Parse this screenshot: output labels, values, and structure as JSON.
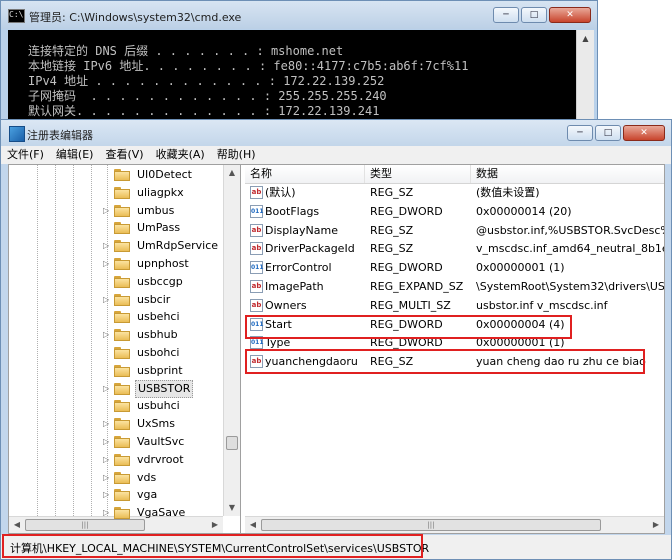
{
  "cmd": {
    "title": "管理员: C:\\Windows\\system32\\cmd.exe",
    "icon_label": "C:\\",
    "lines": [
      "连接特定的 DNS 后缀 . . . . . . . : mshome.net",
      "本地链接 IPv6 地址. . . . . . . . : fe80::4177:c7b5:ab6f:7cf%11",
      "IPv4 地址 . . . . . . . . . . . . : 172.22.139.252",
      "子网掩码  . . . . . . . . . . . . : 255.255.255.240",
      "默认网关. . . . . . . . . . . . . : 172.22.139.241"
    ],
    "buttons": {
      "minimize": "─",
      "maximize": "□",
      "close": "✕"
    }
  },
  "regedit": {
    "title": "注册表编辑器",
    "buttons": {
      "minimize": "─",
      "maximize": "□",
      "close": "✕"
    },
    "menu": [
      "文件(F)",
      "编辑(E)",
      "查看(V)",
      "收藏夹(A)",
      "帮助(H)"
    ],
    "tree_items": [
      {
        "label": "UI0Detect",
        "expander": ""
      },
      {
        "label": "uliagpkx",
        "expander": ""
      },
      {
        "label": "umbus",
        "expander": "▷"
      },
      {
        "label": "UmPass",
        "expander": ""
      },
      {
        "label": "UmRdpService",
        "expander": "▷"
      },
      {
        "label": "upnphost",
        "expander": "▷"
      },
      {
        "label": "usbccgp",
        "expander": ""
      },
      {
        "label": "usbcir",
        "expander": "▷"
      },
      {
        "label": "usbehci",
        "expander": ""
      },
      {
        "label": "usbhub",
        "expander": "▷"
      },
      {
        "label": "usbohci",
        "expander": ""
      },
      {
        "label": "usbprint",
        "expander": ""
      },
      {
        "label": "USBSTOR",
        "expander": "▷",
        "selected": true
      },
      {
        "label": "usbuhci",
        "expander": ""
      },
      {
        "label": "UxSms",
        "expander": "▷"
      },
      {
        "label": "VaultSvc",
        "expander": "▷"
      },
      {
        "label": "vdrvroot",
        "expander": "▷"
      },
      {
        "label": "vds",
        "expander": "▷"
      },
      {
        "label": "vga",
        "expander": "▷"
      },
      {
        "label": "VgaSave",
        "expander": "▷"
      }
    ],
    "columns": {
      "name": "名称",
      "type": "类型",
      "data": "数据"
    },
    "values": [
      {
        "icon": "ab",
        "name": "(默认)",
        "type": "REG_SZ",
        "data": "(数值未设置)"
      },
      {
        "icon": "bin",
        "name": "BootFlags",
        "type": "REG_DWORD",
        "data": "0x00000014 (20)"
      },
      {
        "icon": "ab",
        "name": "DisplayName",
        "type": "REG_SZ",
        "data": "@usbstor.inf,%USBSTOR.SvcDesc%;U"
      },
      {
        "icon": "ab",
        "name": "DriverPackageId",
        "type": "REG_SZ",
        "data": "v_mscdsc.inf_amd64_neutral_8b1e6b5"
      },
      {
        "icon": "bin",
        "name": "ErrorControl",
        "type": "REG_DWORD",
        "data": "0x00000001 (1)"
      },
      {
        "icon": "ab",
        "name": "ImagePath",
        "type": "REG_EXPAND_SZ",
        "data": "\\SystemRoot\\System32\\drivers\\USBS"
      },
      {
        "icon": "ab",
        "name": "Owners",
        "type": "REG_MULTI_SZ",
        "data": "usbstor.inf v_mscdsc.inf"
      },
      {
        "icon": "bin",
        "name": "Start",
        "type": "REG_DWORD",
        "data": "0x00000004 (4)"
      },
      {
        "icon": "bin",
        "name": "Type",
        "type": "REG_DWORD",
        "data": "0x00000001 (1)"
      },
      {
        "icon": "ab",
        "name": "yuanchengdaoru",
        "type": "REG_SZ",
        "data": "yuan cheng dao ru zhu ce biao"
      }
    ],
    "status": "计算机\\HKEY_LOCAL_MACHINE\\SYSTEM\\CurrentControlSet\\services\\USBSTOR",
    "highlight_color": "#e02020"
  }
}
